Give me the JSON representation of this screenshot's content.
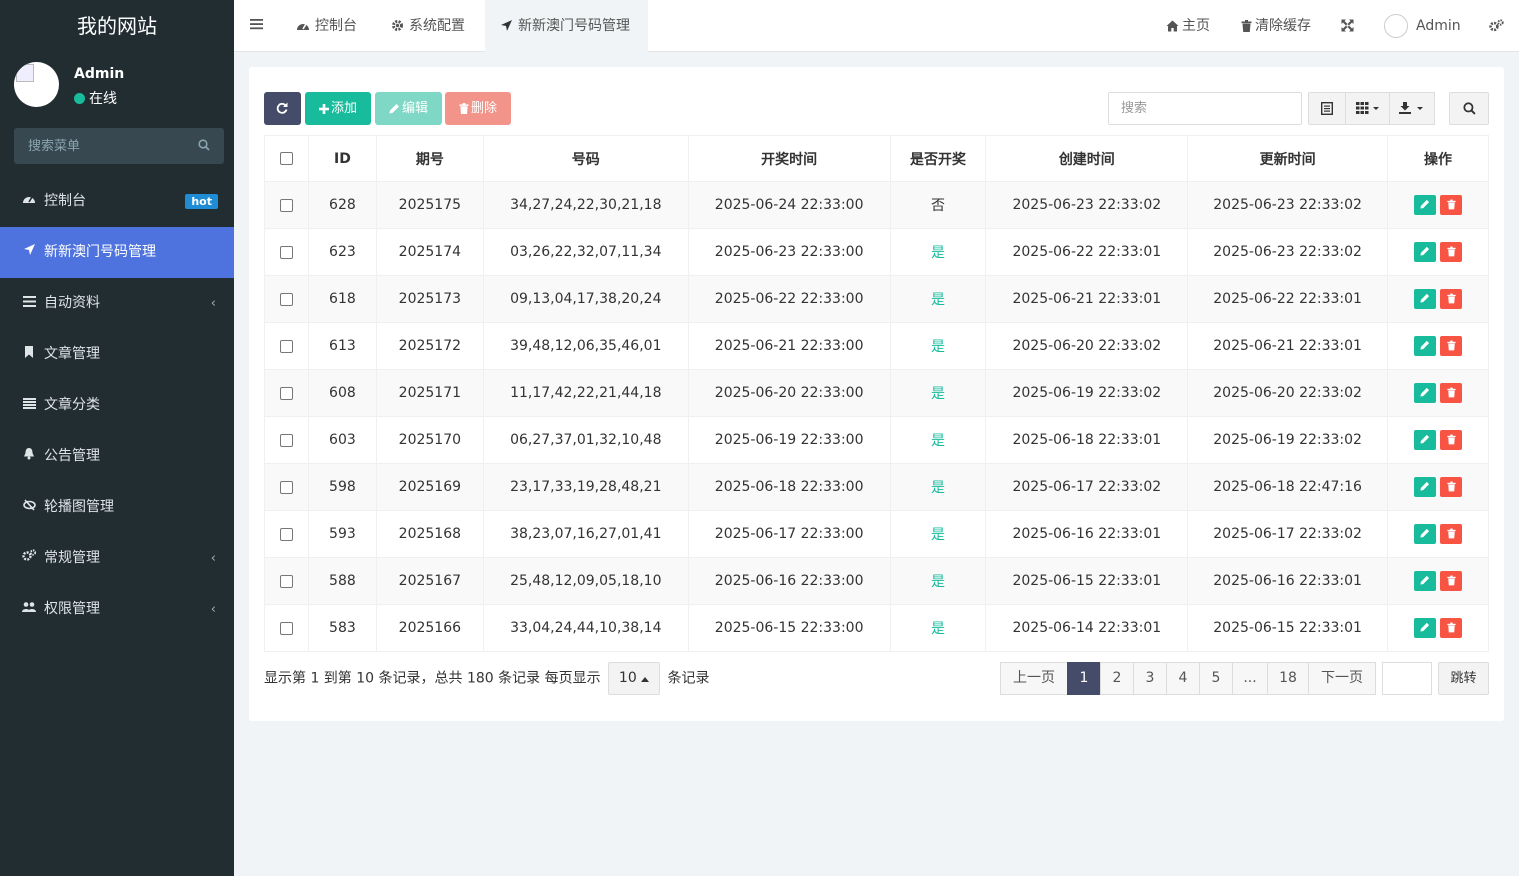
{
  "brand": "我的网站",
  "user": {
    "name": "Admin",
    "status": "在线"
  },
  "sidebar": {
    "search_placeholder": "搜索菜单",
    "items": [
      {
        "label": "控制台",
        "badge": "hot"
      },
      {
        "label": "新新澳门号码管理"
      },
      {
        "label": "自动资料"
      },
      {
        "label": "文章管理"
      },
      {
        "label": "文章分类"
      },
      {
        "label": "公告管理"
      },
      {
        "label": "轮播图管理"
      },
      {
        "label": "常规管理"
      },
      {
        "label": "权限管理"
      }
    ]
  },
  "topbar": {
    "tabs": [
      "控制台",
      "系统配置",
      "新新澳门号码管理"
    ],
    "home": "主页",
    "clear_cache": "清除缓存",
    "admin": "Admin"
  },
  "toolbar": {
    "add": "添加",
    "edit": "编辑",
    "delete": "删除",
    "search_placeholder": "搜索"
  },
  "table": {
    "columns": [
      "ID",
      "期号",
      "号码",
      "开奖时间",
      "是否开奖",
      "创建时间",
      "更新时间",
      "操作"
    ],
    "rows": [
      {
        "id": "628",
        "issue": "2025175",
        "numbers": "34,27,24,22,30,21,18",
        "draw_time": "2025-06-24 22:33:00",
        "drawn": "否",
        "created": "2025-06-23 22:33:02",
        "updated": "2025-06-23 22:33:02"
      },
      {
        "id": "623",
        "issue": "2025174",
        "numbers": "03,26,22,32,07,11,34",
        "draw_time": "2025-06-23 22:33:00",
        "drawn": "是",
        "created": "2025-06-22 22:33:01",
        "updated": "2025-06-23 22:33:02"
      },
      {
        "id": "618",
        "issue": "2025173",
        "numbers": "09,13,04,17,38,20,24",
        "draw_time": "2025-06-22 22:33:00",
        "drawn": "是",
        "created": "2025-06-21 22:33:01",
        "updated": "2025-06-22 22:33:01"
      },
      {
        "id": "613",
        "issue": "2025172",
        "numbers": "39,48,12,06,35,46,01",
        "draw_time": "2025-06-21 22:33:00",
        "drawn": "是",
        "created": "2025-06-20 22:33:02",
        "updated": "2025-06-21 22:33:01"
      },
      {
        "id": "608",
        "issue": "2025171",
        "numbers": "11,17,42,22,21,44,18",
        "draw_time": "2025-06-20 22:33:00",
        "drawn": "是",
        "created": "2025-06-19 22:33:02",
        "updated": "2025-06-20 22:33:02"
      },
      {
        "id": "603",
        "issue": "2025170",
        "numbers": "06,27,37,01,32,10,48",
        "draw_time": "2025-06-19 22:33:00",
        "drawn": "是",
        "created": "2025-06-18 22:33:01",
        "updated": "2025-06-19 22:33:02"
      },
      {
        "id": "598",
        "issue": "2025169",
        "numbers": "23,17,33,19,28,48,21",
        "draw_time": "2025-06-18 22:33:00",
        "drawn": "是",
        "created": "2025-06-17 22:33:02",
        "updated": "2025-06-18 22:47:16"
      },
      {
        "id": "593",
        "issue": "2025168",
        "numbers": "38,23,07,16,27,01,41",
        "draw_time": "2025-06-17 22:33:00",
        "drawn": "是",
        "created": "2025-06-16 22:33:01",
        "updated": "2025-06-17 22:33:02"
      },
      {
        "id": "588",
        "issue": "2025167",
        "numbers": "25,48,12,09,05,18,10",
        "draw_time": "2025-06-16 22:33:00",
        "drawn": "是",
        "created": "2025-06-15 22:33:01",
        "updated": "2025-06-16 22:33:01"
      },
      {
        "id": "583",
        "issue": "2025166",
        "numbers": "33,04,24,44,10,38,14",
        "draw_time": "2025-06-15 22:33:00",
        "drawn": "是",
        "created": "2025-06-14 22:33:01",
        "updated": "2025-06-15 22:33:01"
      }
    ]
  },
  "pagination": {
    "info_prefix": "显示第 1 到第 10 条记录，总共 180 条记录 每页显示",
    "page_size": "10",
    "info_suffix": "条记录",
    "prev": "上一页",
    "pages": [
      "1",
      "2",
      "3",
      "4",
      "5",
      "...",
      "18"
    ],
    "next": "下一页",
    "jump": "跳转"
  },
  "colors": {
    "sidebar_bg": "#222d32",
    "active_menu": "#4e73df",
    "refresh_btn": "#444c69",
    "add_btn": "#18bc9c",
    "edit_btn": "#7fd8c6",
    "delete_btn": "#f3948b",
    "yes_text": "#18bc9c"
  }
}
